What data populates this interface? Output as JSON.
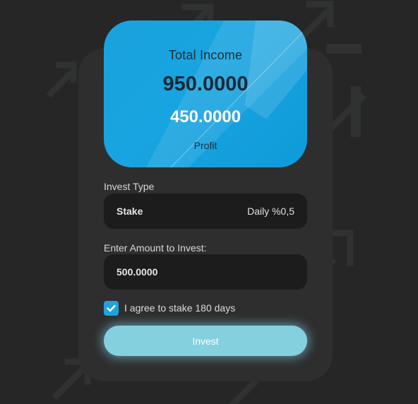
{
  "card": {
    "title": "Total Income",
    "total": "950.0000",
    "profit_value": "450.0000",
    "profit_label": "Profit"
  },
  "invest_type": {
    "label": "Invest Type",
    "name": "Stake",
    "rate": "Daily %0,5"
  },
  "amount": {
    "label": "Enter Amount to Invest:",
    "value": "500.0000"
  },
  "agree": {
    "checked": true,
    "text": "I agree to stake 180 days"
  },
  "invest_button": {
    "label": "Invest"
  },
  "colors": {
    "background": "#262626",
    "panel": "#2e2e2e",
    "card_blue": "#18a4e0",
    "field": "#1c1c1c",
    "button": "#84d0df",
    "checkbox": "#1ea3dc"
  }
}
